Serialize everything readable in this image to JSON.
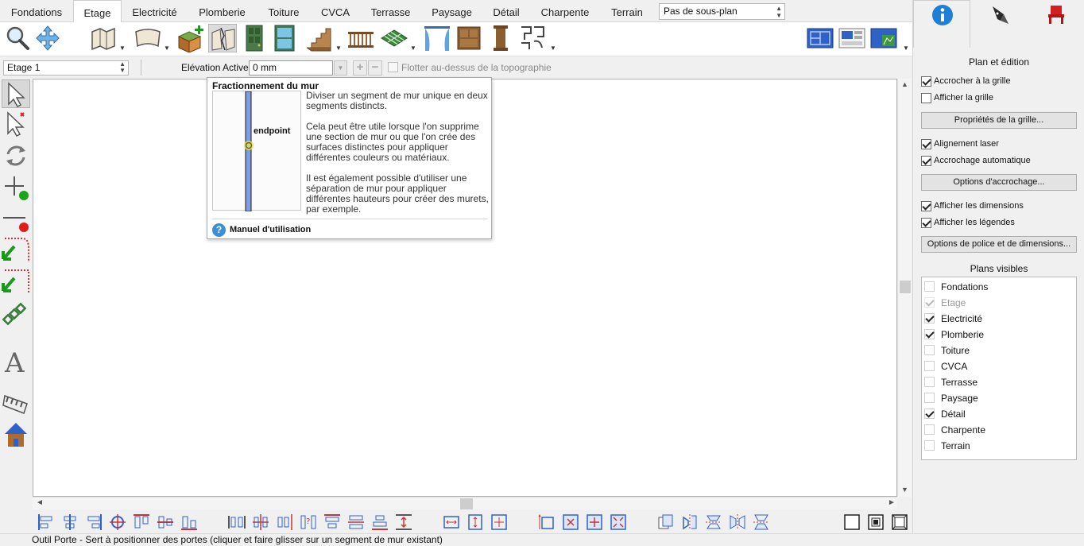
{
  "tabs": [
    {
      "label": "Fondations"
    },
    {
      "label": "Etage",
      "active": true
    },
    {
      "label": "Electricité"
    },
    {
      "label": "Plomberie"
    },
    {
      "label": "Toiture"
    },
    {
      "label": "CVCA"
    },
    {
      "label": "Terrasse"
    },
    {
      "label": "Paysage"
    },
    {
      "label": "Détail"
    },
    {
      "label": "Charpente"
    },
    {
      "label": "Terrain"
    }
  ],
  "subplan": {
    "selected": "Pas de sous-plan"
  },
  "subbar": {
    "floor": "Etage 1",
    "elevation_label": "Elévation Active:",
    "elevation_value": "0 mm",
    "float_label": "Flotter au-dessus de la topographie"
  },
  "tooltip": {
    "title": "Fractionnement du mur",
    "image_label": "endpoint",
    "paragraphs": [
      "Diviser un segment de mur unique en deux segments distincts.",
      "Cela peut être utile lorsque l'on supprime une section de mur ou que l'on crée des surfaces distinctes pour appliquer différentes couleurs ou matériaux.",
      "Il est également possible d'utiliser une séparation de mur pour appliquer différentes hauteurs pour créer des murets, par exemple."
    ],
    "help_icon": "?",
    "help_label": "Manuel d'utilisation"
  },
  "status": {
    "text": "Outil Porte - Sert à  positionner des portes (cliquer et faire glisser sur un segment de mur existant)"
  },
  "panel": {
    "section_title": "Plan et édition",
    "snap_grid": {
      "label": "Accrocher à la grille",
      "checked": true
    },
    "show_grid": {
      "label": "Afficher la grille",
      "checked": false
    },
    "grid_props_button": "Propriétés de la grille...",
    "laser_align": {
      "label": "Alignement laser",
      "checked": true
    },
    "auto_snap": {
      "label": "Accrochage automatique",
      "checked": true
    },
    "snap_options_button": "Options d'accrochage...",
    "show_dims": {
      "label": "Afficher les dimensions",
      "checked": true
    },
    "show_legends": {
      "label": "Afficher les légendes",
      "checked": true
    },
    "font_dims_button": "Options de police et de dimensions...",
    "visible_plans_title": "Plans visibles",
    "visible_plans": [
      {
        "label": "Fondations",
        "state": "off"
      },
      {
        "label": "Etage",
        "state": "disabled"
      },
      {
        "label": "Electricité",
        "state": "on"
      },
      {
        "label": "Plomberie",
        "state": "on"
      },
      {
        "label": "Toiture",
        "state": "off"
      },
      {
        "label": "CVCA",
        "state": "off"
      },
      {
        "label": "Terrasse",
        "state": "off"
      },
      {
        "label": "Paysage",
        "state": "off"
      },
      {
        "label": "Détail",
        "state": "on"
      },
      {
        "label": "Charpente",
        "state": "off"
      },
      {
        "label": "Terrain",
        "state": "off"
      }
    ]
  },
  "colors": {
    "accent_blue": "#1e7fd6",
    "active_tab_bg": "#ffffff",
    "panel_bg": "#f0f0f0"
  }
}
